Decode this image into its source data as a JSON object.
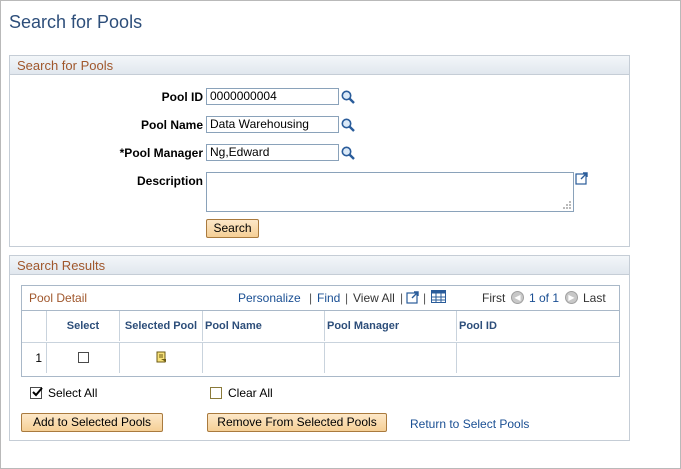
{
  "page": {
    "title": "Search for Pools"
  },
  "search_group": {
    "header": "Search for Pools",
    "pool_id": {
      "label": "Pool ID",
      "value": "0000000004"
    },
    "pool_name": {
      "label": "Pool Name",
      "value": "Data Warehousing"
    },
    "pool_manager": {
      "label": "*Pool Manager",
      "value": "Ng,Edward"
    },
    "description": {
      "label": "Description",
      "value": ""
    },
    "search_button": "Search"
  },
  "results_group": {
    "header": "Search Results",
    "grid": {
      "title": "Pool Detail",
      "nav": {
        "personalize": "Personalize",
        "find": "Find",
        "view_all": "View All",
        "first": "First",
        "range": "1 of 1",
        "last": "Last"
      },
      "columns": [
        "Select",
        "Selected Pool",
        "Pool Name",
        "Pool Manager",
        "Pool ID"
      ],
      "rows": [
        {
          "num": "1",
          "select": false,
          "pool_name": "",
          "pool_manager": "",
          "pool_id": ""
        }
      ]
    },
    "select_all": "Select All",
    "clear_all": "Clear All",
    "add_button": "Add to Selected Pools",
    "remove_button": "Remove From Selected Pools",
    "return_link": "Return to Select Pools"
  }
}
